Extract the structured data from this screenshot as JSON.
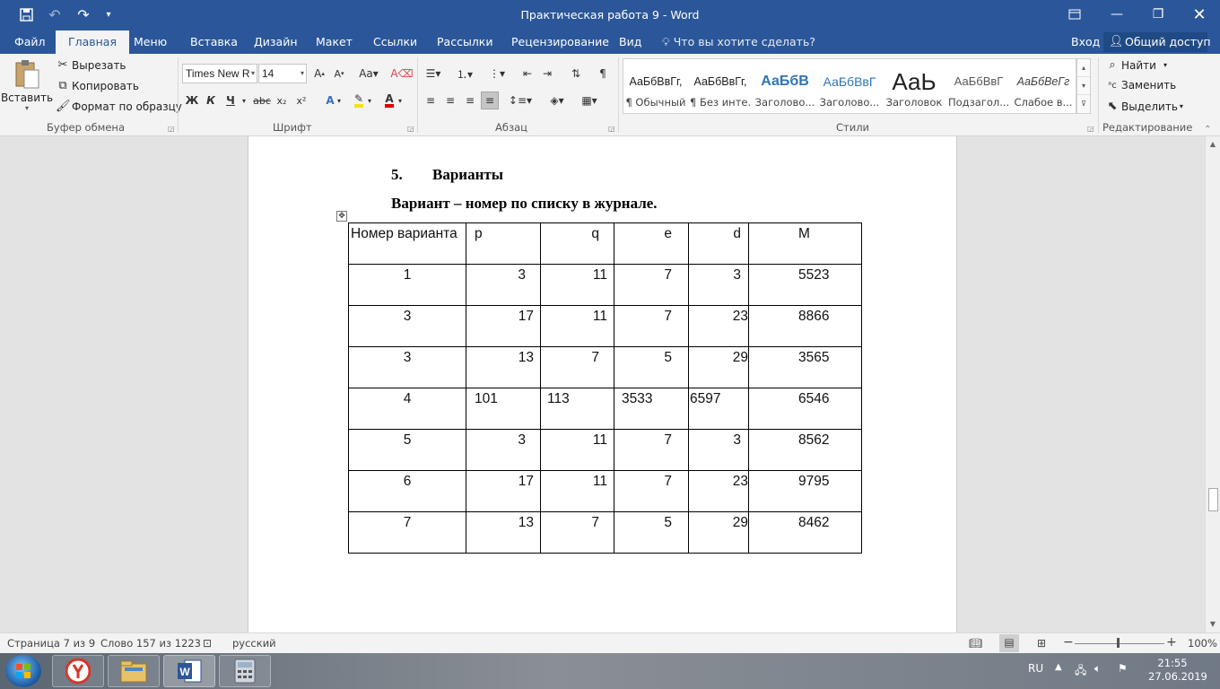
{
  "window": {
    "title": "Практическая работа 9 - Word"
  },
  "tabs": [
    "Файл",
    "Главная",
    "Меню",
    "Вставка",
    "Дизайн",
    "Макет",
    "Ссылки",
    "Рассылки",
    "Рецензирование",
    "Вид"
  ],
  "tell_me": "Что вы хотите сделать?",
  "signin": "Вход",
  "share": "Общий доступ",
  "clipboard": {
    "paste": "Вставить",
    "cut": "Вырезать",
    "copy": "Копировать",
    "format_painter": "Формат по образцу",
    "label": "Буфер обмена"
  },
  "font": {
    "name": "Times New R",
    "size": "14",
    "bold": "Ж",
    "italic": "К",
    "underline": "Ч",
    "label": "Шрифт"
  },
  "paragraph": {
    "label": "Абзац"
  },
  "styles": {
    "label": "Стили",
    "items": [
      {
        "preview": "АаБбВвГг,",
        "name": "¶ Обычный"
      },
      {
        "preview": "АаБбВвГг,",
        "name": "¶ Без инте..."
      },
      {
        "preview": "АаБбВ",
        "name": "Заголово..."
      },
      {
        "preview": "АаБбВвГ",
        "name": "Заголово..."
      },
      {
        "preview": "АаЬ",
        "name": "Заголовок"
      },
      {
        "preview": "АаБбВвГ",
        "name": "Подзагол..."
      },
      {
        "preview": "АаБбВеГг",
        "name": "Слабое в..."
      }
    ]
  },
  "editing": {
    "find": "Найти",
    "replace": "Заменить",
    "select": "Выделить",
    "label": "Редактирование"
  },
  "document": {
    "heading_number": "5.",
    "heading_text": "Варианты",
    "subheading": "Вариант – номер по списку в журнале.",
    "table": {
      "headers": [
        "Номер варианта",
        "p",
        "q",
        "e",
        "d",
        "M"
      ],
      "rows": [
        [
          "1",
          "3",
          "11",
          "7",
          "3",
          "5523"
        ],
        [
          "3",
          "17",
          "11",
          "7",
          "23",
          "8866"
        ],
        [
          "3",
          "13",
          "7",
          "5",
          "29",
          "3565"
        ],
        [
          "4",
          "101",
          "113",
          "3533",
          "6597",
          "6546"
        ],
        [
          "5",
          "3",
          "11",
          "7",
          "3",
          "8562"
        ],
        [
          "6",
          "17",
          "11",
          "7",
          "23",
          "9795"
        ],
        [
          "7",
          "13",
          "7",
          "5",
          "29",
          "8462"
        ]
      ]
    }
  },
  "status": {
    "page": "Страница 7 из 9",
    "words": "Слово 157 из 1223",
    "language": "русский",
    "zoom": "100%"
  },
  "tray": {
    "lang": "RU",
    "time": "21:55",
    "date": "27.06.2019"
  }
}
